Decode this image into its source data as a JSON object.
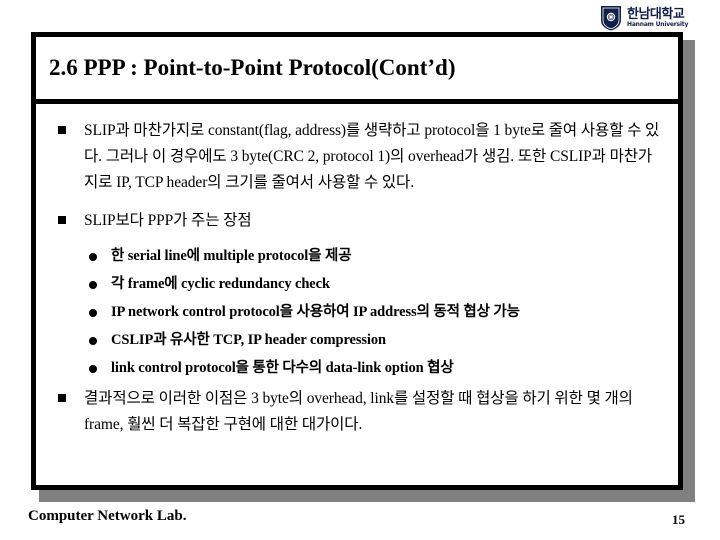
{
  "logo": {
    "icon": "shield-emblem-icon",
    "korean_name": "한남대학교",
    "english_name": "Hannam University",
    "color": "#11204a"
  },
  "slide": {
    "title": "2.6 PPP : Point-to-Point Protocol(Cont’d)",
    "border_color": "#000000",
    "shadow_color": "#808080",
    "bullets": [
      {
        "level": 1,
        "marker": "square",
        "text": "SLIP과 마찬가지로 constant(flag, address)를 생략하고 protocol을 1 byte로 줄여 사용할 수 있다. 그러나 이 경우에도 3 byte(CRC 2, protocol 1)의 overhead가 생김. 또한 CSLIP과 마찬가지로 IP, TCP header의 크기를 줄여서 사용할 수 있다."
      },
      {
        "level": 1,
        "marker": "square",
        "text": "SLIP보다 PPP가 주는 장점"
      },
      {
        "level": 2,
        "marker": "disc",
        "text": "한 serial line에 multiple protocol을 제공"
      },
      {
        "level": 2,
        "marker": "disc",
        "text": "각 frame에 cyclic redundancy check"
      },
      {
        "level": 2,
        "marker": "disc",
        "text": "IP network control protocol을 사용하여 IP address의 동적 협상 가능"
      },
      {
        "level": 2,
        "marker": "disc",
        "text": "CSLIP과 유사한 TCP, IP header compression"
      },
      {
        "level": 2,
        "marker": "disc",
        "text": "link control protocol을 통한 다수의 data-link option 협상"
      },
      {
        "level": 1,
        "marker": "square",
        "text": "결과적으로 이러한 이점은 3 byte의 overhead, link를 설정할 때 협상을 하기 위한 몇 개의 frame, 훨씬 더 복잡한 구현에 대한 대가이다."
      }
    ]
  },
  "footer": {
    "lab_name": "Computer Network Lab.",
    "page_number": "15"
  }
}
